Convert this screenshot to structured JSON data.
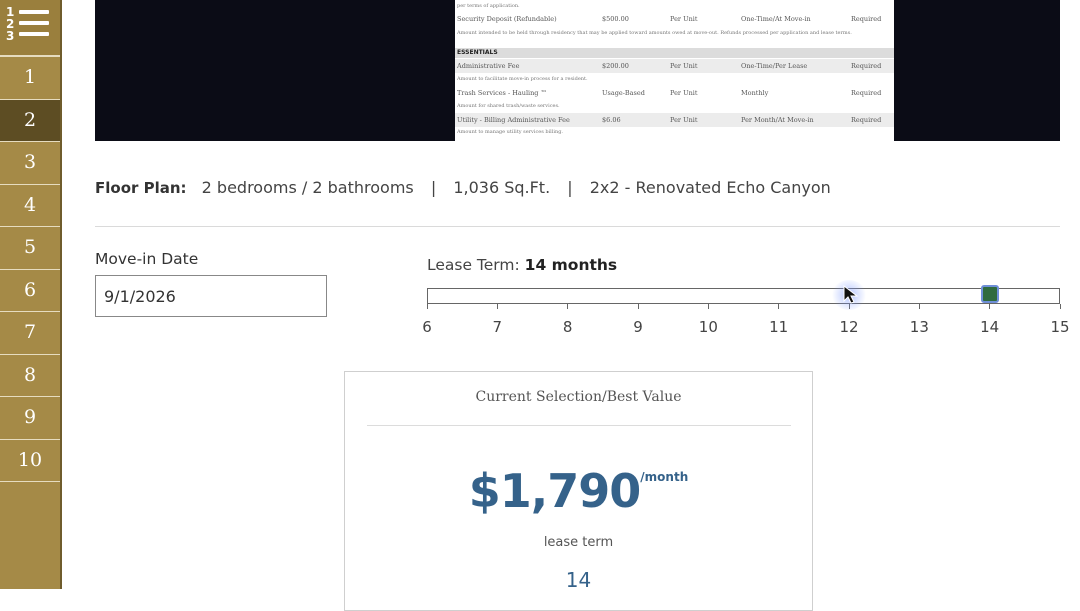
{
  "sidebar": {
    "menu_digits": [
      "1",
      "2",
      "3"
    ],
    "steps": [
      "1",
      "2",
      "3",
      "4",
      "5",
      "6",
      "7",
      "8",
      "9",
      "10"
    ],
    "active_step": "2"
  },
  "fee_document": {
    "top_note": "per terms of application.",
    "rows": [
      {
        "name": "Security Deposit (Refundable)",
        "amount": "$500.00",
        "basis": "Per Unit",
        "frequency": "One-Time/At Move-in",
        "required": "Required",
        "note": "Amount intended to be held through residency that may be applied toward amounts owed at move-out. Refunds processed per application and lease terms."
      }
    ],
    "section_title": "ESSENTIALS",
    "essentials": [
      {
        "name": "Administrative Fee",
        "amount": "$200.00",
        "basis": "Per Unit",
        "frequency": "One-Time/Per Lease",
        "required": "Required",
        "note": "Amount to facilitate move-in process for a resident."
      },
      {
        "name": "Trash Services - Hauling ™",
        "amount": "Usage-Based",
        "basis": "Per Unit",
        "frequency": "Monthly",
        "required": "Required",
        "note": "Amount for shared trash/waste services."
      },
      {
        "name": "Utility - Billing Administrative Fee",
        "amount": "$6.06",
        "basis": "Per Unit",
        "frequency": "Per Month/At Move-in",
        "required": "Required",
        "note": "Amount to manage utility services billing."
      }
    ]
  },
  "floor_plan": {
    "label": "Floor Plan:",
    "beds_baths": "2 bedrooms / 2 bathrooms",
    "separator": "|",
    "sqft": "1,036 Sq.Ft.",
    "plan_name": "2x2 - Renovated Echo Canyon"
  },
  "move_in": {
    "label": "Move-in Date",
    "value": "9/1/2026"
  },
  "lease_term": {
    "label": "Lease Term:",
    "selected_text": "14 months",
    "min": 6,
    "max": 15,
    "value": 14,
    "ticks": [
      "6",
      "7",
      "8",
      "9",
      "10",
      "11",
      "12",
      "13",
      "14",
      "15"
    ],
    "thumb_color": "#2f6b3f"
  },
  "price_card": {
    "title": "Current Selection/Best Value",
    "amount": "$1,790",
    "unit": "/month",
    "term_label": "lease term",
    "term_value": "14",
    "accent_color": "#35628a"
  },
  "cursor": {
    "icon": "arrow-pointer-icon"
  }
}
